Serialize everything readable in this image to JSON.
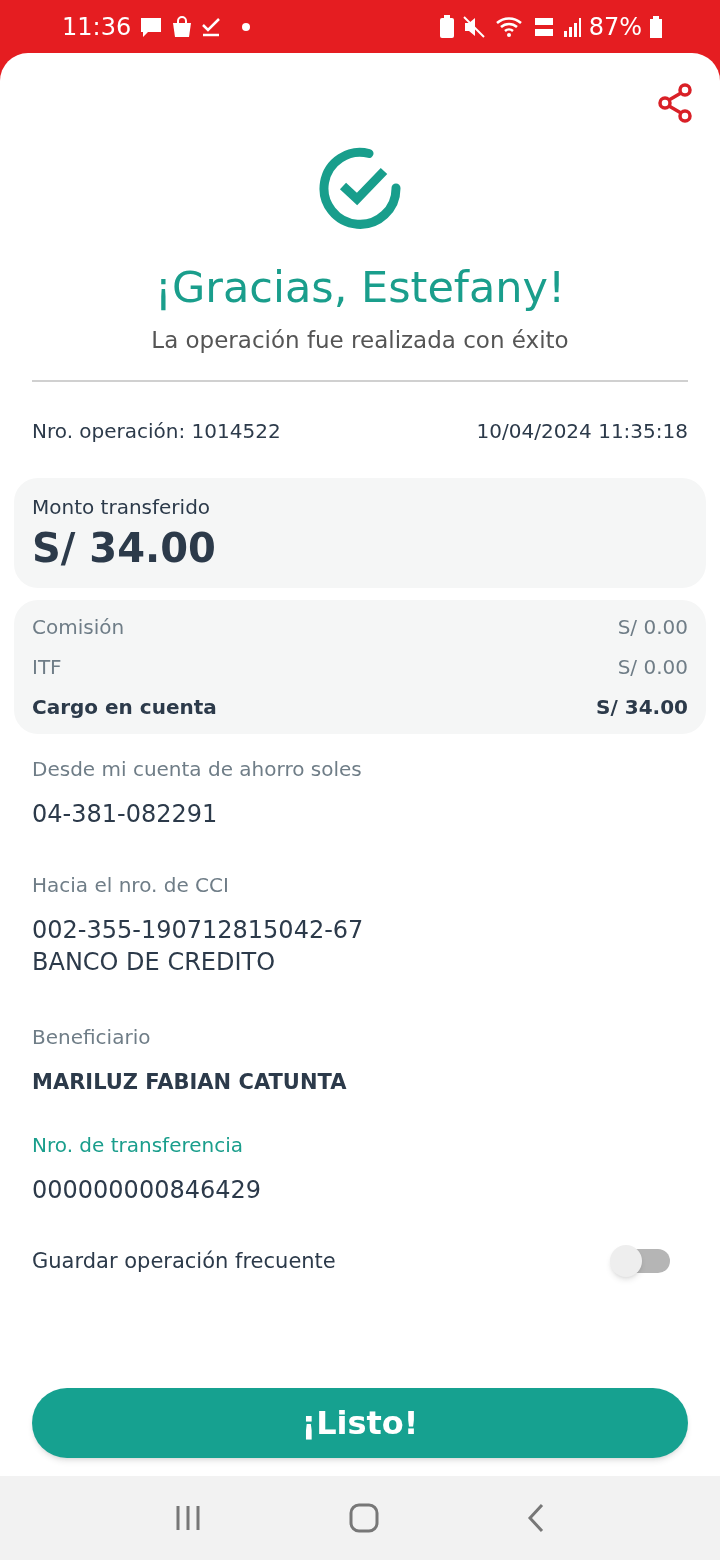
{
  "status_bar": {
    "time": "11:36",
    "battery": "87%"
  },
  "title": "¡Gracias, Estefany!",
  "subtitle": "La operación fue realizada con éxito",
  "operation": {
    "number": "Nro. operación: 1014522",
    "datetime": "10/04/2024 11:35:18"
  },
  "amount": {
    "label": "Monto transferido",
    "value": "S/ 34.00"
  },
  "charges": [
    {
      "label": "Comisión",
      "value": "S/ 0.00",
      "kind": "item"
    },
    {
      "label": "ITF",
      "value": "S/ 0.00",
      "kind": "item"
    },
    {
      "label": "Cargo en cuenta",
      "value": "S/ 34.00",
      "kind": "total"
    }
  ],
  "details": [
    {
      "label": "Desde mi cuenta de ahorro soles",
      "lines": [
        "04-381-082291"
      ],
      "kind": "plain"
    },
    {
      "label": "Hacia el nro. de CCI",
      "lines": [
        "002-355-190712815042-67",
        "BANCO DE CREDITO"
      ],
      "kind": "plain"
    },
    {
      "label": "Beneficiario",
      "lines": [
        "MARILUZ FABIAN CATUNTA"
      ],
      "kind": "name"
    },
    {
      "label": "Nro. de transferencia",
      "lines": [
        "000000000846429"
      ],
      "kind": "reference"
    }
  ],
  "save_frequent": {
    "label": "Guardar operación frecuente",
    "on": false
  },
  "done_button": {
    "label": "¡Listo!"
  }
}
